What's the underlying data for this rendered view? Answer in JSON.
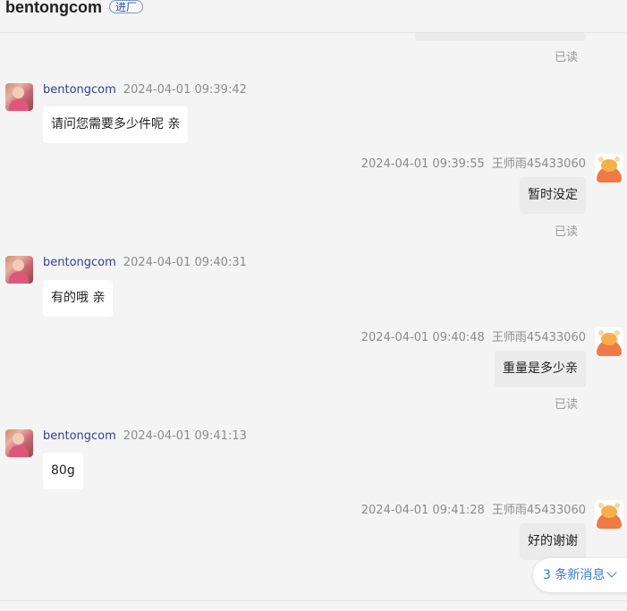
{
  "header": {
    "title": "bentongcom",
    "tag": "进厂"
  },
  "chat": {
    "top_read": "已读",
    "messages": [
      {
        "side": "left",
        "name": "bentongcom",
        "time": "2024-04-01 09:39:42",
        "text": "请问您需要多少件呢 亲"
      },
      {
        "side": "right",
        "name": "王师雨45433060",
        "time": "2024-04-01 09:39:55",
        "text": "暂时没定",
        "status": "已读"
      },
      {
        "side": "left",
        "name": "bentongcom",
        "time": "2024-04-01 09:40:31",
        "text": "有的哦 亲"
      },
      {
        "side": "right",
        "name": "王师雨45433060",
        "time": "2024-04-01 09:40:48",
        "text": "重量是多少亲",
        "status": "已读"
      },
      {
        "side": "left",
        "name": "bentongcom",
        "time": "2024-04-01 09:41:13",
        "text": "80g"
      },
      {
        "side": "right",
        "name": "王师雨45433060",
        "time": "2024-04-01 09:41:28",
        "text": "好的谢谢"
      }
    ],
    "new_messages_label": "3 条新消息"
  },
  "icons": {
    "left_avatar": "user-avatar-photo",
    "right_avatar": "cartoon-avatar-icon",
    "chevron": "chevron-down-icon"
  },
  "colors": {
    "name_link": "#333f8c",
    "accent": "#3b7bd6"
  }
}
